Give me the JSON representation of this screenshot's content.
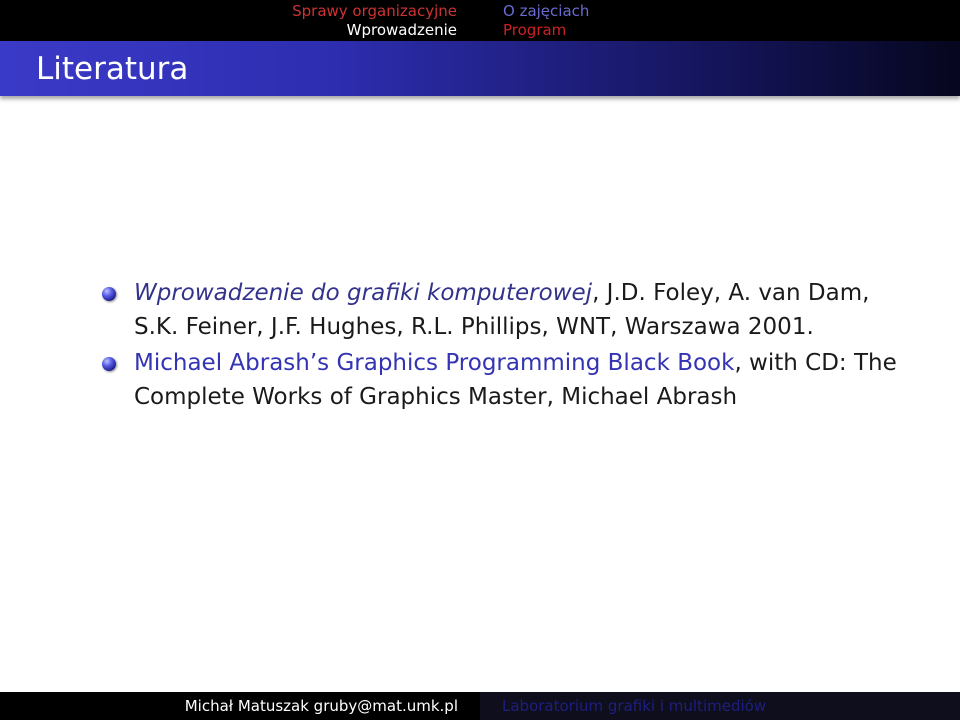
{
  "nav": {
    "left": [
      "Sprawy organizacyjne",
      "Wprowadzenie"
    ],
    "right": [
      "O zajęciach",
      "Program"
    ],
    "colors": {
      "sprawy": "#cc3333",
      "wprowadzenie": "#ffffff",
      "o_zajeciach": "#6a6ad0",
      "program": "#cc2222"
    }
  },
  "frame_title": "Literatura",
  "items": [
    {
      "italic": "Wprowadzenie do grafiki komputerowej",
      "rest": ", J.D. Foley, A. van Dam, S.K. Feiner, J.F. Hughes, R.L. Phillips, WNT, Warszawa 2001."
    },
    {
      "highlight": "Michael Abrash’s Graphics Programming Black Book",
      "rest": ", with CD: The Complete Works of Graphics Master, Michael Abrash"
    }
  ],
  "footer": {
    "left": "Michał Matuszak gruby@mat.umk.pl",
    "right": "Laboratorium grafiki i multimediów"
  }
}
